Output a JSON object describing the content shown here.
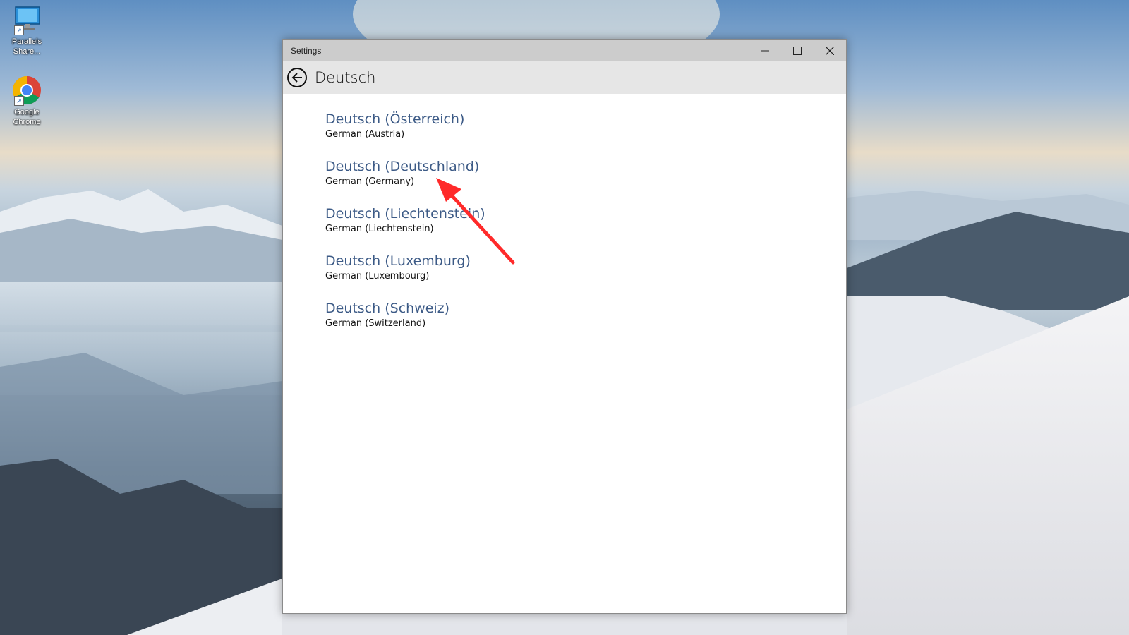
{
  "desktop": {
    "icons": [
      {
        "label": "Parallels Share...",
        "icon": "monitor-icon"
      },
      {
        "label": "Google Chrome",
        "icon": "chrome-icon"
      }
    ]
  },
  "window": {
    "title": "Settings",
    "controls": {
      "minimize": "minimize-icon",
      "maximize": "maximize-icon",
      "close": "close-icon"
    },
    "header": {
      "title": "Deutsch",
      "back_icon": "back-arrow-icon"
    },
    "languages": [
      {
        "native": "Deutsch (Österreich)",
        "english": "German (Austria)"
      },
      {
        "native": "Deutsch (Deutschland)",
        "english": "German (Germany)"
      },
      {
        "native": "Deutsch (Liechtenstein)",
        "english": "German (Liechtenstein)"
      },
      {
        "native": "Deutsch (Luxemburg)",
        "english": "German (Luxembourg)"
      },
      {
        "native": "Deutsch (Schweiz)",
        "english": "German (Switzerland)"
      }
    ]
  },
  "colors": {
    "link": "#3c5a86",
    "annotation_arrow": "#ff2a2a"
  }
}
